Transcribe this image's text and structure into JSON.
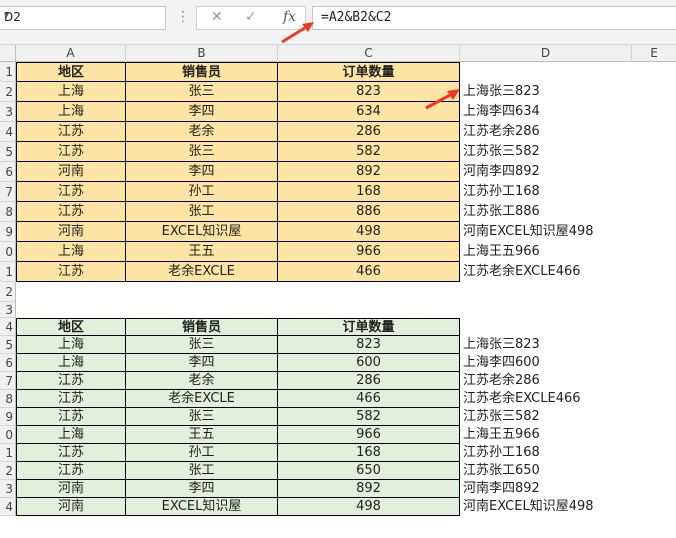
{
  "name_box": "D2",
  "formula": "=A2&B2&C2",
  "fx_label": "fx",
  "cancel_icon": "✕",
  "enter_icon": "✓",
  "columns": [
    "A",
    "B",
    "C",
    "D",
    "E"
  ],
  "headers": {
    "region": "地区",
    "seller": "销售员",
    "qty": "订单数量"
  },
  "table1": [
    {
      "r": "2",
      "a": "上海",
      "b": "张三",
      "c": "823",
      "d": "上海张三823"
    },
    {
      "r": "3",
      "a": "上海",
      "b": "李四",
      "c": "634",
      "d": "上海李四634"
    },
    {
      "r": "4",
      "a": "江苏",
      "b": "老余",
      "c": "286",
      "d": "江苏老余286"
    },
    {
      "r": "5",
      "a": "江苏",
      "b": "张三",
      "c": "582",
      "d": "江苏张三582"
    },
    {
      "r": "6",
      "a": "河南",
      "b": "李四",
      "c": "892",
      "d": "河南李四892"
    },
    {
      "r": "7",
      "a": "江苏",
      "b": "孙工",
      "c": "168",
      "d": "江苏孙工168"
    },
    {
      "r": "8",
      "a": "江苏",
      "b": "张工",
      "c": "886",
      "d": "江苏张工886"
    },
    {
      "r": "9",
      "a": "河南",
      "b": "EXCEL知识屋",
      "c": "498",
      "d": "河南EXCEL知识屋498"
    },
    {
      "r": "0",
      "a": "上海",
      "b": "王五",
      "c": "966",
      "d": "上海王五966"
    },
    {
      "r": "1",
      "a": "江苏",
      "b": "老余EXCLE",
      "c": "466",
      "d": "江苏老余EXCLE466"
    }
  ],
  "row_numbers_top": {
    "header": "1",
    "blank1": "2",
    "blank2": "3",
    "header2": "4"
  },
  "table2": [
    {
      "r": "5",
      "a": "上海",
      "b": "张三",
      "c": "823",
      "d": "上海张三823"
    },
    {
      "r": "6",
      "a": "上海",
      "b": "李四",
      "c": "600",
      "d": "上海李四600"
    },
    {
      "r": "7",
      "a": "江苏",
      "b": "老余",
      "c": "286",
      "d": "江苏老余286"
    },
    {
      "r": "8",
      "a": "江苏",
      "b": "老余EXCLE",
      "c": "466",
      "d": "江苏老余EXCLE466"
    },
    {
      "r": "9",
      "a": "江苏",
      "b": "张三",
      "c": "582",
      "d": "江苏张三582"
    },
    {
      "r": "0",
      "a": "上海",
      "b": "王五",
      "c": "966",
      "d": "上海王五966"
    },
    {
      "r": "1",
      "a": "江苏",
      "b": "孙工",
      "c": "168",
      "d": "江苏孙工168"
    },
    {
      "r": "2",
      "a": "江苏",
      "b": "张工",
      "c": "650",
      "d": "江苏张工650"
    },
    {
      "r": "3",
      "a": "河南",
      "b": "李四",
      "c": "892",
      "d": "河南李四892"
    },
    {
      "r": "4",
      "a": "河南",
      "b": "EXCEL知识屋",
      "c": "498",
      "d": "河南EXCEL知识屋498"
    }
  ],
  "colors": {
    "yellow": "#fce4a4",
    "green": "#e2efda",
    "arrow": "#ea3b25"
  }
}
